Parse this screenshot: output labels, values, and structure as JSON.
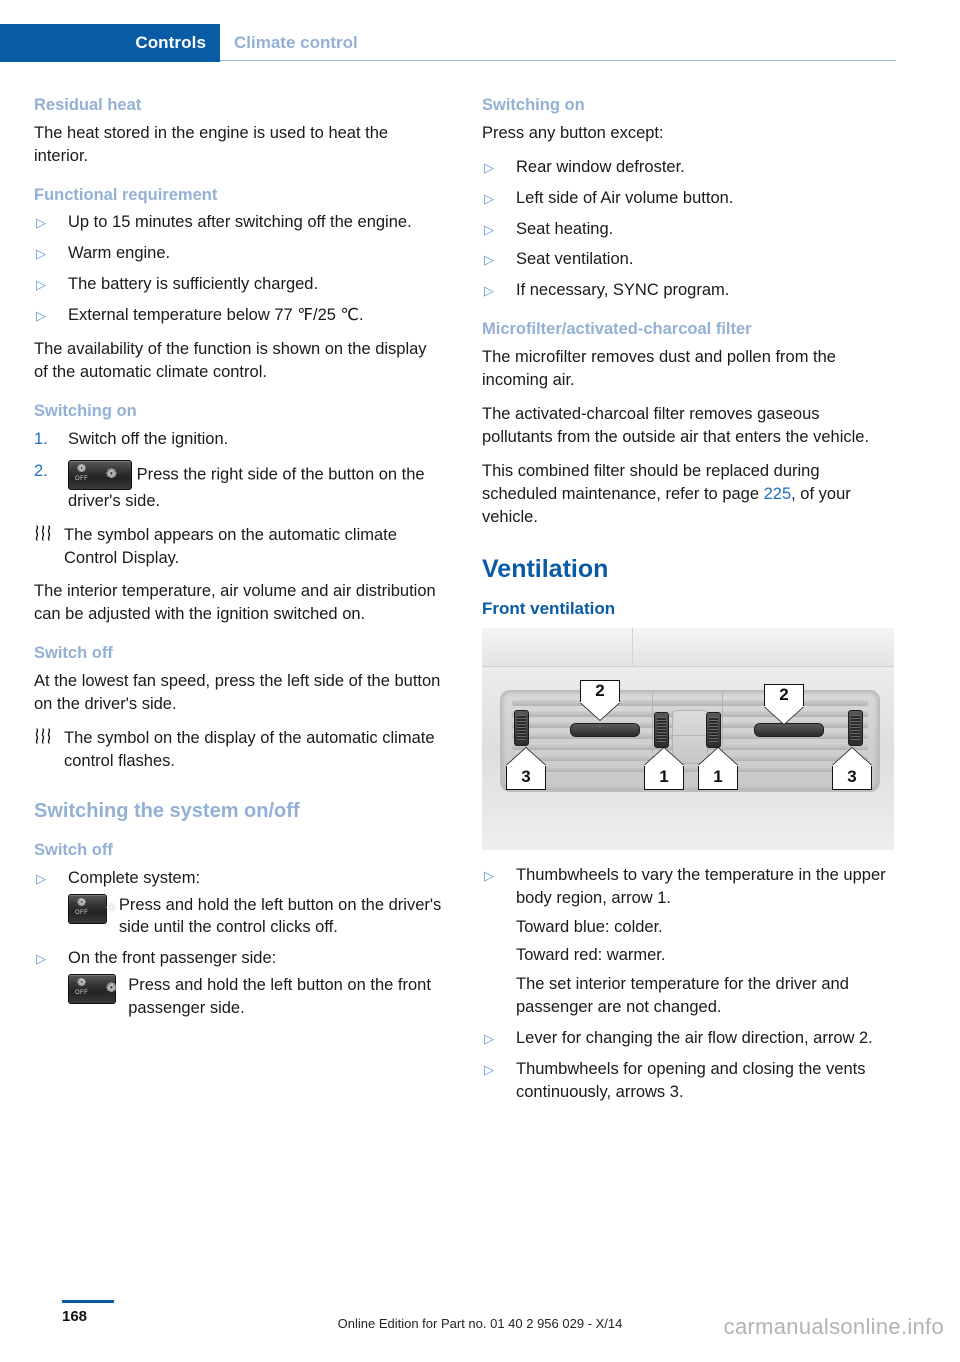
{
  "header": {
    "breadcrumb_active": "Controls",
    "breadcrumb_section": "Climate control"
  },
  "left_column": {
    "h_residual_heat": "Residual heat",
    "p_intro": "The heat stored in the engine is used to heat the interior.",
    "h_functional_requirement": "Functional requirement",
    "functional_requirements": [
      "Up to 15 minutes after switching off the engine.",
      "Warm engine.",
      "The battery is sufficiently charged.",
      "External temperature below 77 ℉/25 ℃."
    ],
    "p_availability": "The availability of the function is shown on the display of the automatic climate control.",
    "h_switching_on": "Switching on",
    "step_1_num": "1.",
    "step_1_text": "Switch off the ignition.",
    "step_2_num": "2.",
    "step_2_text": "Press the right side of the button on the driver's side.",
    "note_symbol_appears": "The symbol appears on the automatic climate Control Display.",
    "p_interior_temp": "The interior temperature, air volume and air distribution can be adjusted with the ignition switched on.",
    "h_switch_off_1": "Switch off",
    "p_lowest_fan": "At the lowest fan speed, press the left side of the button on the driver's side.",
    "note_symbol_flashes": "The symbol on the display of the automatic climate control flashes.",
    "h_switching_system": "Switching the system on/off",
    "h_switch_off_2": "Switch off",
    "bullet_complete_system": "Complete system:",
    "complete_system_text": "Press and hold the left button on the driver's side until the control clicks off.",
    "bullet_passenger_side": "On the front passenger side:",
    "passenger_side_text": "Press and hold the left button on the front passenger side."
  },
  "right_column": {
    "h_switching_on": "Switching on",
    "p_press_any": "Press any button except:",
    "exceptions": [
      "Rear window defroster.",
      "Left side of Air volume button.",
      "Seat heating.",
      "Seat ventilation.",
      "If necessary, SYNC program."
    ],
    "h_microfilter": "Microfilter/activated-charcoal filter",
    "p_microfilter": "The microfilter removes dust and pollen from the incoming air.",
    "p_charcoal": "The activated-charcoal filter removes gaseous pollutants from the outside air that enters the vehicle.",
    "p_combined_pre": "This combined filter should be replaced during scheduled maintenance, refer to page ",
    "p_combined_pageref": "225",
    "p_combined_post": ", of your vehicle.",
    "h_ventilation": "Ventilation",
    "h_front_ventilation": "Front ventilation",
    "figure": {
      "callout_1_left": "1",
      "callout_1_right": "1",
      "callout_2_left": "2",
      "callout_2_right": "2",
      "callout_3_left": "3",
      "callout_3_right": "3"
    },
    "vent_items": [
      {
        "main": "Thumbwheels to vary the temperature in the upper body region, arrow 1.",
        "sublines": [
          "Toward blue: colder.",
          "Toward red: warmer.",
          "The set interior temperature for the driver and passenger are not changed."
        ]
      },
      {
        "main": "Lever for changing the air flow direction, arrow 2.",
        "sublines": []
      },
      {
        "main": "Thumbwheels for opening and closing the vents continuously, arrows 3.",
        "sublines": []
      }
    ]
  },
  "footer": {
    "page_number": "168",
    "edition": "Online Edition for Part no. 01 40 2 956 029 - X/14",
    "watermark": "carmanualsonline.info"
  },
  "icons": {
    "bullet": "▷",
    "heat_waves": "⸮",
    "fan": "❁",
    "off_label": "OFF"
  },
  "colors": {
    "brand_blue": "#0a5ba6",
    "light_blue_heading": "#93b0d5",
    "link_blue": "#1f6fc4"
  }
}
